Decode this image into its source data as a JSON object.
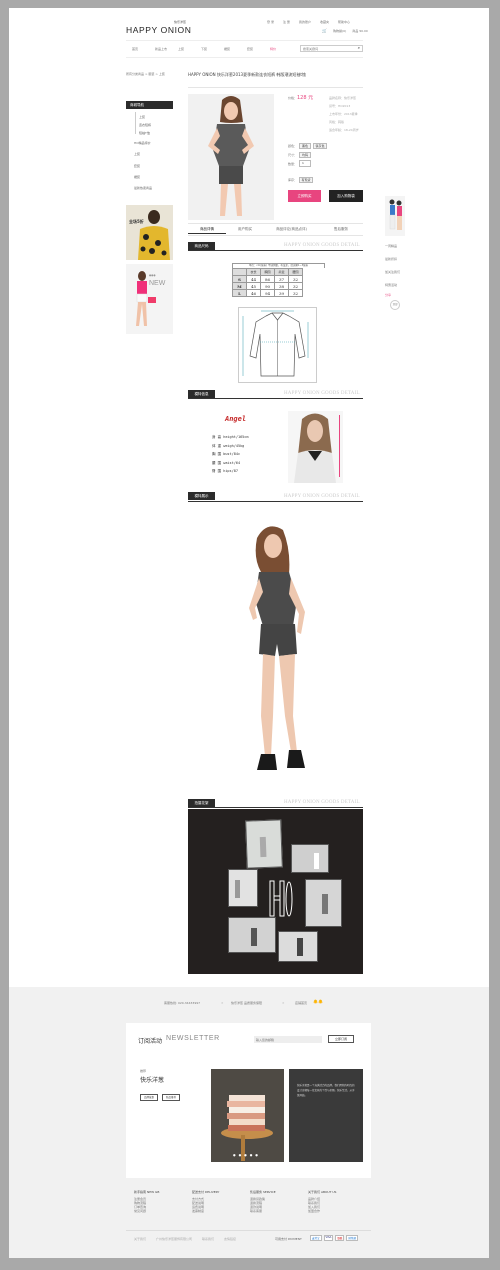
{
  "brand": {
    "logo": "HAPPY ONION",
    "logo_sub": "快乐洋葱"
  },
  "topbar": {
    "links": [
      "登 录",
      "注 册",
      "我的账户",
      "收藏夹",
      "帮助中心"
    ],
    "cart": "购物袋(0)",
    "total": "商品 ¥0.00"
  },
  "nav": {
    "items": [
      "首页",
      "新品上市",
      "上装",
      "下装",
      "裙装",
      "套装",
      "特价"
    ],
    "search_placeholder": "搜索关键词"
  },
  "breadcrumb": "所有分类商品 > 服装 > 上装",
  "product": {
    "title": "HAPPY ONION 快乐洋葱2013夏季新款连衣短裤 韩版潮流短袖t恤",
    "price_label": "价格：",
    "price": "128 元",
    "info_lines": [
      "品牌名称：快乐洋葱",
      "货号：HO2013",
      "上市年份：2013夏季",
      "风格：韩版",
      "适合年龄：18-24周岁"
    ],
    "color_label": "颜色：",
    "colors": [
      "黑色",
      "铁灰色"
    ],
    "size_label": "尺寸：",
    "size_value": "均码",
    "qty_label": "数量：",
    "qty_value": "1",
    "stock_label": "库存：",
    "stock_value": "有现货",
    "buy_label": "立即购买",
    "cart_label": "加入购物袋"
  },
  "sidebar": {
    "header": "商城导航",
    "items": [
      "上装",
      "连衣短裤",
      "短袖T恤",
      "HO精品特价",
      "上装",
      "套装",
      "裙装",
      "最新热卖商品"
    ],
    "promo_text": "全场5折",
    "new_text": "NEW"
  },
  "tabs": [
    "商品详情",
    "用户购买",
    "商品评论(商品点评)",
    "售后服务"
  ],
  "sections": {
    "size": {
      "tag": "商品尺码",
      "en": "HAPPY ONION GOODS DETAIL"
    },
    "model": {
      "tag": "模特信息",
      "en": "HAPPY ONION GOODS DETAIL"
    },
    "show": {
      "tag": "模特展示",
      "en": "HAPPY ONION GOODS DETAIL"
    },
    "shoot": {
      "tag": "拍摄花絮",
      "en": "HAPPY ONION GOODS DETAIL"
    }
  },
  "size_table": {
    "caption": "单位：cm(厘米) 平铺测量，有误差，请谅解1~3厘米",
    "headers": [
      "",
      "衣长",
      "胸围",
      "肩宽",
      "腰围"
    ],
    "rows": [
      [
        "S",
        "44",
        "86",
        "37",
        "32"
      ],
      [
        "M",
        "45",
        "90",
        "38",
        "32"
      ],
      [
        "L",
        "46",
        "94",
        "39",
        "32"
      ]
    ]
  },
  "model": {
    "name": "Angel",
    "specs": [
      "身 高  height/165cm",
      "体 重  weigh/45kg",
      "胸 围  bust/84c",
      "腰 围  waist/64",
      "臀 围  hips/87"
    ]
  },
  "right_rail": {
    "items": [
      "一周精品",
      "最新折扣",
      "加关注我们",
      "特惠活动"
    ],
    "share": "分享",
    "top": "顶部"
  },
  "footer_bar": {
    "phone": "客服热线: 020-34433997",
    "service": "快乐洋葱 品质服务保障",
    "shop": "店铺首页"
  },
  "newsletter": {
    "title_cn": "订阅活动",
    "title_en": "NEWSLETTER",
    "input_placeholder": "输入您的邮箱",
    "subscribe": "立即订阅",
    "tag": "推荐",
    "brand_cn": "快乐洋葱",
    "btn1": "品牌故事",
    "btn2": "新品推荐",
    "card_text": "快乐洋葱是一个充满活力的品牌，我们用简约时尚的设计诠释每一位女孩的个性与美丽。快乐生活，从洋葱开始。"
  },
  "footer_cols": [
    {
      "head": "新手指南 NEW GB",
      "items": [
        "注册会员",
        "购物流程",
        "订单查询",
        "常见问题"
      ]
    },
    {
      "head": "配送支付 DELIVERY",
      "items": [
        "支付方式",
        "配送说明",
        "运费说明",
        "发票制度"
      ]
    },
    {
      "head": "售后服务 SERVICE",
      "items": [
        "退换货政策",
        "退换流程",
        "退款说明",
        "联系客服"
      ]
    },
    {
      "head": "关于我们 ABOUT US",
      "items": [
        "品牌介绍",
        "联系我们",
        "加入我们",
        "加盟合作"
      ]
    }
  ],
  "bottom": {
    "links": [
      "关于我们",
      "广州快乐洋葱服饰有限公司",
      "联系我们",
      "友情链接"
    ],
    "payment_label": "可用支付 PAYMENT",
    "payments": [
      "支付宝",
      "VISA",
      "银联",
      "财付通"
    ]
  }
}
